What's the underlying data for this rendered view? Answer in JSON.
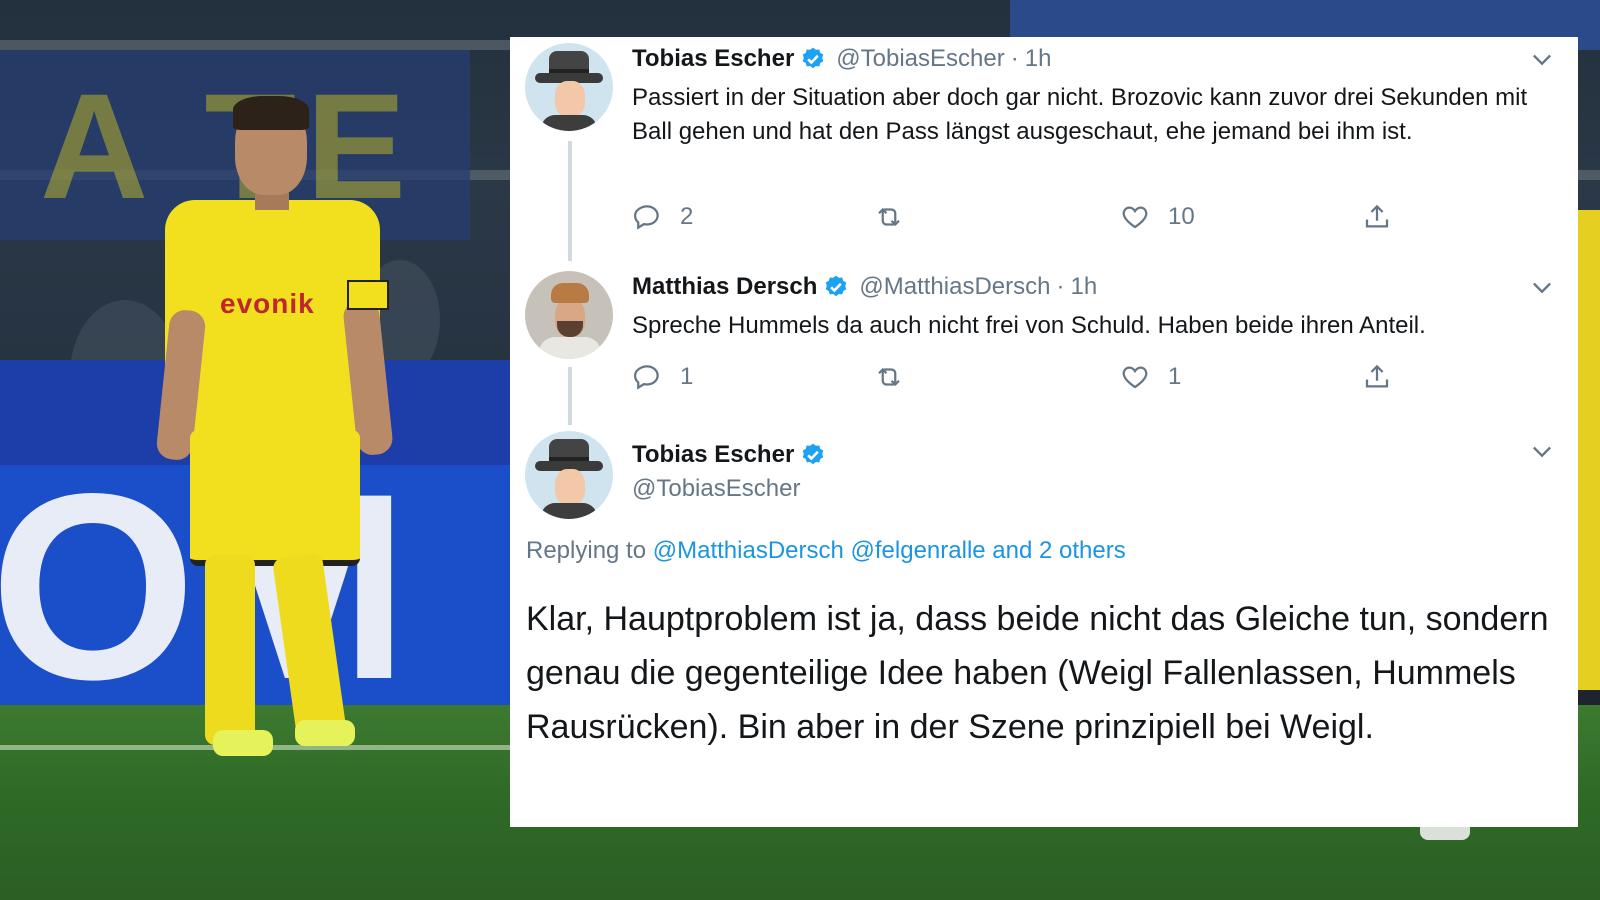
{
  "tweets": [
    {
      "name": "Tobias Escher",
      "handle": "@TobiasEscher",
      "time": "1h",
      "text": "Passiert in der Situation aber doch gar nicht. Brozovic kann zuvor drei Sekunden mit Ball gehen und hat den Pass längst ausgeschaut, ehe jemand bei ihm ist.",
      "replies": "2",
      "retweets": "",
      "likes": "10"
    },
    {
      "name": "Matthias Dersch",
      "handle": "@MatthiasDersch",
      "time": "1h",
      "text": "Spreche Hummels da auch nicht frei von Schuld. Haben beide ihren Anteil.",
      "replies": "1",
      "retweets": "",
      "likes": "1"
    }
  ],
  "main_tweet": {
    "name": "Tobias Escher",
    "handle": "@TobiasEscher",
    "replying_prefix": "Replying to",
    "replying_links": [
      "@MatthiasDersch",
      "@felgenralle",
      "and 2 others"
    ],
    "text": "Klar, Hauptproblem ist ja, dass beide nicht das Gleiche tun, sondern genau die gegenteilige Idee haben (Weigl Fallenlassen, Hummels Rausrücken). Bin aber in der Szene prinzipiell bei Weigl."
  },
  "photo": {
    "sponsor_text": "evonik"
  },
  "colors": {
    "link": "#1b95e0",
    "verified": "#1da1f2",
    "muted": "#657786",
    "text": "#14171a",
    "jersey": "#f2df1e"
  },
  "icons": [
    "reply-icon",
    "retweet-icon",
    "like-icon",
    "share-icon",
    "chevron-down-icon",
    "verified-badge-icon"
  ]
}
